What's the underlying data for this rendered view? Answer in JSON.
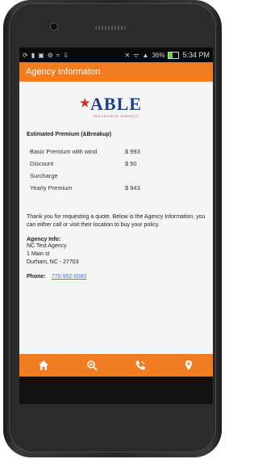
{
  "status_bar": {
    "time": "5:34 PM",
    "battery_percent_text": "36%",
    "battery_level": 0.36
  },
  "app_bar": {
    "title": "Agency Informaton"
  },
  "logo": {
    "word": "ABLE",
    "tagline": "INSURANCE AGENCY"
  },
  "estimate": {
    "title": "Estimated Premium (&Breakup)",
    "rows": [
      {
        "label": "Basic Premium with wind",
        "value": "$ 993"
      },
      {
        "label": "Discount",
        "value": "$ 50"
      },
      {
        "label": "Surcharge",
        "value": ""
      },
      {
        "label": "Yearly Premium",
        "value": "$ 943"
      }
    ]
  },
  "message": "Thank you for requesting a quote. Below is the Agency Information, you can either call or visit their location to buy your policy.",
  "agency": {
    "title": "Agency Info:",
    "name": "NC Test Agency",
    "street": "1 Main st",
    "city": "Durham, NC - 27703"
  },
  "contact": {
    "label": "Phone:",
    "number": "770-952-0080"
  },
  "tabs": [
    {
      "icon": "home-icon"
    },
    {
      "icon": "search-icon"
    },
    {
      "icon": "call-icon"
    },
    {
      "icon": "location-icon"
    }
  ],
  "colors": {
    "accent": "#f07d22",
    "link": "#3a7fd0",
    "logo_blue": "#1d3f8f"
  }
}
